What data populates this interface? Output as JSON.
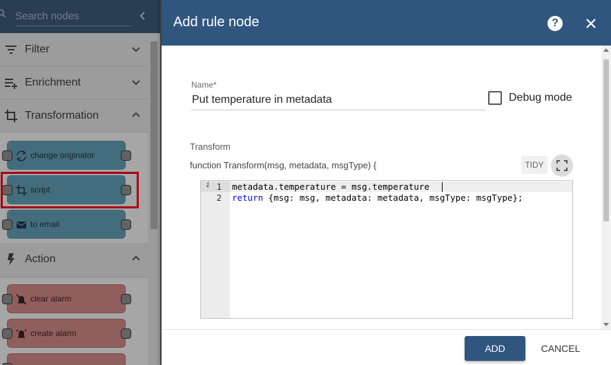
{
  "library": {
    "search_placeholder": "Search nodes",
    "categories": [
      {
        "label": "Filter",
        "icon": "filter-icon",
        "expanded": false
      },
      {
        "label": "Enrichment",
        "icon": "playlist-add-icon",
        "expanded": false
      },
      {
        "label": "Transformation",
        "icon": "crop-icon",
        "expanded": true
      },
      {
        "label": "Action",
        "icon": "flash-icon",
        "expanded": true
      }
    ],
    "transformation_nodes": [
      {
        "label": "change originator",
        "icon": "repeat-icon"
      },
      {
        "label": "script",
        "icon": "crop-icon",
        "highlighted": true
      },
      {
        "label": "to email",
        "icon": "mail-icon"
      }
    ],
    "action_nodes": [
      {
        "label": "clear alarm",
        "icon": "alarm-off-icon"
      },
      {
        "label": "create alarm",
        "icon": "alarm-add-icon"
      }
    ]
  },
  "dialog": {
    "title": "Add rule node",
    "help_glyph": "?",
    "name": {
      "label": "Name",
      "required_mark": "*",
      "value": "Put temperature in metadata"
    },
    "debug": {
      "label": "Debug mode",
      "checked": false
    },
    "transform": {
      "label": "Transform",
      "signature": "function Transform(msg, metadata, msgType) {",
      "tidy_label": "TIDY",
      "code_lines": [
        {
          "number": "1",
          "text": "metadata.temperature = msg.temperature"
        },
        {
          "number": "2",
          "keyword": "return",
          "text": " {msg: msg, metadata: metadata, msgType: msgType};"
        }
      ],
      "info_glyph": "i"
    },
    "actions": {
      "add_label": "ADD",
      "cancel_label": "CANCEL"
    }
  },
  "colors": {
    "header": "#305680",
    "node_blue": "#5e97ac",
    "node_red": "#c98383",
    "highlight": "#e8001c"
  }
}
